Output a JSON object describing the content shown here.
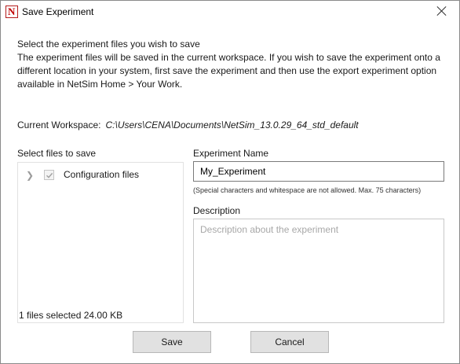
{
  "window": {
    "title": "Save Experiment",
    "app_icon": "netsim-logo",
    "app_icon_glyph": "N"
  },
  "intro": {
    "line1": "Select the experiment files you wish to save",
    "line2": "The experiment files will be saved in the current workspace. If you wish to save the experiment onto a",
    "line3": "different location in your system, first save the experiment and then use the export experiment option",
    "line4": "available in NetSim Home > Your Work."
  },
  "workspace": {
    "label": "Current Workspace:",
    "path": "C:\\Users\\CENA\\Documents\\NetSim_13.0.29_64_std_default"
  },
  "files": {
    "label": "Select files to save",
    "items": [
      {
        "label": "Configuration files",
        "checked": true,
        "expanded": false
      }
    ],
    "status": "1 files selected 24.00 KB"
  },
  "experiment_name": {
    "label": "Experiment Name",
    "value": "My_Experiment",
    "hint": "(Special characters and whitespace are not allowed. Max. 75 characters)"
  },
  "description": {
    "label": "Description",
    "value": "",
    "placeholder": "Description about the experiment"
  },
  "buttons": {
    "save": "Save",
    "cancel": "Cancel"
  }
}
